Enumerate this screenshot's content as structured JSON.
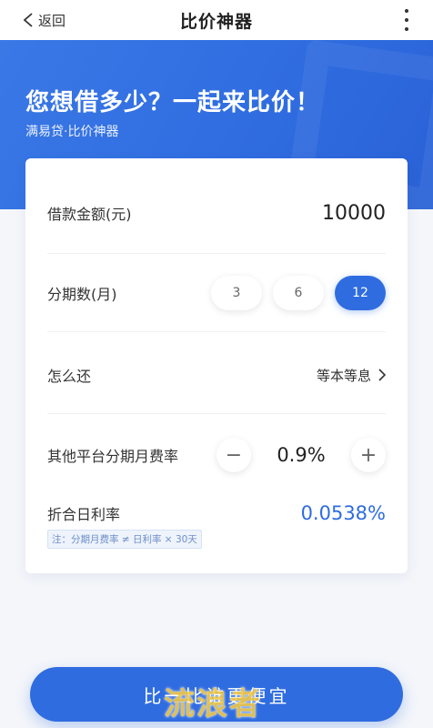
{
  "nav": {
    "back_label": "返回",
    "title": "比价神器",
    "back_icon": "chevron-left-icon",
    "more_icon": "more-vertical-icon"
  },
  "hero": {
    "title": "您想借多少？一起来比价！",
    "subtitle": "满易贷·比价神器"
  },
  "form": {
    "amount": {
      "label": "借款金额(元)",
      "value": "10000"
    },
    "period": {
      "label": "分期数(月)",
      "options": [
        "3",
        "6",
        "12"
      ],
      "selected": "12"
    },
    "repay": {
      "label": "怎么还",
      "value": "等本等息"
    },
    "rate": {
      "label": "其他平台分期月费率",
      "value": "0.9%",
      "minus": "−",
      "plus": "+"
    },
    "daily": {
      "label": "折合日利率",
      "value": "0.0538%",
      "note": "注：分期月费率 ≠ 日利率 × 30天"
    }
  },
  "cta": {
    "label": "比一比谁更便宜",
    "watermark": "流浪者"
  },
  "colors": {
    "accent": "#2f6ce0",
    "hero_bg": "#3a78e6",
    "page_bg": "#f4f6fa"
  }
}
